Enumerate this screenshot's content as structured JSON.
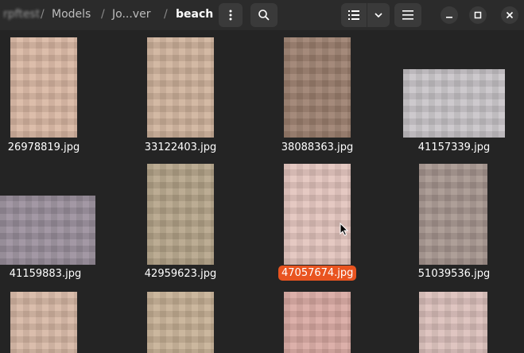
{
  "breadcrumb": {
    "parent_blurred": "rpftest",
    "separator": "/",
    "models": "Models",
    "jo": "Jo...ver",
    "current": "beach"
  },
  "toolbar": {
    "menu_icon": "vertical-ellipsis-icon",
    "search_icon": "search-icon",
    "view_icon": "list-view-icon",
    "view_options_icon": "chevron-down-icon",
    "main_menu_icon": "hamburger-icon"
  },
  "window": {
    "minimize_icon": "minimize-icon",
    "maximize_icon": "maximize-icon",
    "close_icon": "close-icon"
  },
  "accent_color": "#e95420",
  "files": [
    {
      "name": "26978819.jpg",
      "selected": false
    },
    {
      "name": "33122403.jpg",
      "selected": false
    },
    {
      "name": "38088363.jpg",
      "selected": false
    },
    {
      "name": "41157339.jpg",
      "selected": false
    },
    {
      "name": "41159883.jpg",
      "selected": false
    },
    {
      "name": "42959623.jpg",
      "selected": false
    },
    {
      "name": "47057674.jpg",
      "selected": true
    },
    {
      "name": "51039536.jpg",
      "selected": false
    }
  ]
}
